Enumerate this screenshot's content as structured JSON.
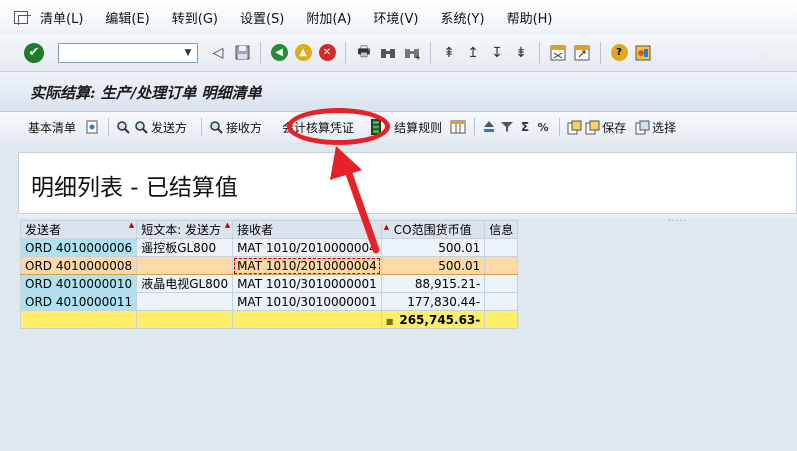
{
  "menu": {
    "items": [
      "清单(L)",
      "编辑(E)",
      "转到(G)",
      "设置(S)",
      "附加(A)",
      "环境(V)",
      "系统(Y)",
      "帮助(H)"
    ]
  },
  "command_field": {
    "value": ""
  },
  "title": "实际结算: 生产/处理订单 明细清单",
  "app_toolbar": {
    "basic_list": "基本清单",
    "sender": "发送方",
    "receiver": "接收方",
    "accounting_docs": "会计核算凭证",
    "settlement_rule": "结算规则",
    "save": "保存",
    "select": "选择"
  },
  "heading": "明细列表 - 已结算值",
  "grid": {
    "columns": [
      "发送者",
      "短文本: 发送方",
      "接收者",
      "CO范围货币值",
      "信息"
    ],
    "rows": [
      {
        "sender": "ORD 4010000006",
        "short_text": "遥控板GL800",
        "receiver": "MAT 1010/2010000004",
        "amount": "500.01",
        "info": ""
      },
      {
        "sender": "ORD 4010000008",
        "short_text": "",
        "receiver": "MAT 1010/2010000004",
        "amount": "500.01",
        "info": ""
      },
      {
        "sender": "ORD 4010000010",
        "short_text": "液晶电视GL800",
        "receiver": "MAT 1010/3010000001",
        "amount": "88,915.21-",
        "info": ""
      },
      {
        "sender": "ORD 4010000011",
        "short_text": "",
        "receiver": "MAT 1010/3010000001",
        "amount": "177,830.44-",
        "info": ""
      }
    ],
    "total": "265,745.63-",
    "total_marker": "■"
  },
  "colors": {
    "annotation": "#e82127",
    "key_cell": "#aee1f2",
    "selected_row": "#fcd9a6",
    "total_row": "#ffee6a"
  }
}
